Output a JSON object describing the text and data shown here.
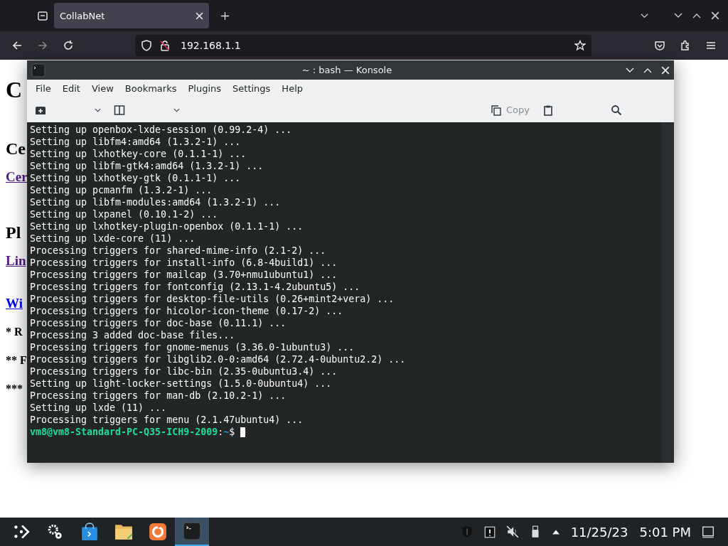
{
  "browser": {
    "tabs": [
      {
        "label": "CollabNet",
        "selected": true
      }
    ],
    "address": "192.168.1.1"
  },
  "page": {
    "fragments": [
      {
        "kind": "h1",
        "text": "C"
      },
      {
        "kind": "h2",
        "text": "Ce"
      },
      {
        "kind": "visited",
        "text": "Cer"
      },
      {
        "kind": "h2",
        "text": "Pl"
      },
      {
        "kind": "visited",
        "text": "Lin"
      },
      {
        "kind": "link",
        "text": "Wi"
      },
      {
        "kind": "bold",
        "text": "* R"
      },
      {
        "kind": "bold",
        "text": "** F"
      },
      {
        "kind": "bold",
        "text": "***"
      }
    ]
  },
  "konsole": {
    "title": "~ : bash — Konsole",
    "menu": [
      "File",
      "Edit",
      "View",
      "Bookmarks",
      "Plugins",
      "Settings",
      "Help"
    ],
    "toolbar_left": [
      {
        "kind": "new-tab"
      },
      {
        "kind": "split"
      }
    ],
    "toolbar_right": [
      {
        "kind": "copy",
        "label": "Copy"
      },
      {
        "kind": "paste"
      },
      {
        "kind": "find"
      }
    ],
    "lines": [
      "Setting up openbox-lxde-session (0.99.2-4) ...",
      "Setting up libfm4:amd64 (1.3.2-1) ...",
      "Setting up lxhotkey-core (0.1.1-1) ...",
      "Setting up libfm-gtk4:amd64 (1.3.2-1) ...",
      "Setting up lxhotkey-gtk (0.1.1-1) ...",
      "Setting up pcmanfm (1.3.2-1) ...",
      "Setting up libfm-modules:amd64 (1.3.2-1) ...",
      "Setting up lxpanel (0.10.1-2) ...",
      "Setting up lxhotkey-plugin-openbox (0.1.1-1) ...",
      "Setting up lxde-core (11) ...",
      "Processing triggers for shared-mime-info (2.1-2) ...",
      "Processing triggers for install-info (6.8-4build1) ...",
      "Processing triggers for mailcap (3.70+nmu1ubuntu1) ...",
      "Processing triggers for fontconfig (2.13.1-4.2ubuntu5) ...",
      "Processing triggers for desktop-file-utils (0.26+mint2+vera) ...",
      "Processing triggers for hicolor-icon-theme (0.17-2) ...",
      "Processing triggers for doc-base (0.11.1) ...",
      "Processing 3 added doc-base files...",
      "Processing triggers for gnome-menus (3.36.0-1ubuntu3) ...",
      "Processing triggers for libglib2.0-0:amd64 (2.72.4-0ubuntu2.2) ...",
      "Processing triggers for libc-bin (2.35-0ubuntu3.4) ...",
      "Setting up light-locker-settings (1.5.0-0ubuntu4) ...",
      "Processing triggers for man-db (2.10.2-1) ...",
      "Setting up lxde (11) ...",
      "Processing triggers for menu (2.1.47ubuntu4) ..."
    ],
    "prompt": {
      "user_host": "vm8@vm8-Standard-PC-Q35-ICH9-2009",
      "separator": ":",
      "path": "~",
      "symbol": "$"
    }
  },
  "taskbar": {
    "apps": [
      {
        "kind": "launcher",
        "selected": false
      },
      {
        "kind": "settings",
        "selected": false
      },
      {
        "kind": "store",
        "selected": false
      },
      {
        "kind": "folder",
        "selected": false
      },
      {
        "kind": "firefox",
        "selected": false
      },
      {
        "kind": "terminal",
        "selected": true
      }
    ],
    "date": "11/25/23",
    "time": "5:01 PM"
  }
}
